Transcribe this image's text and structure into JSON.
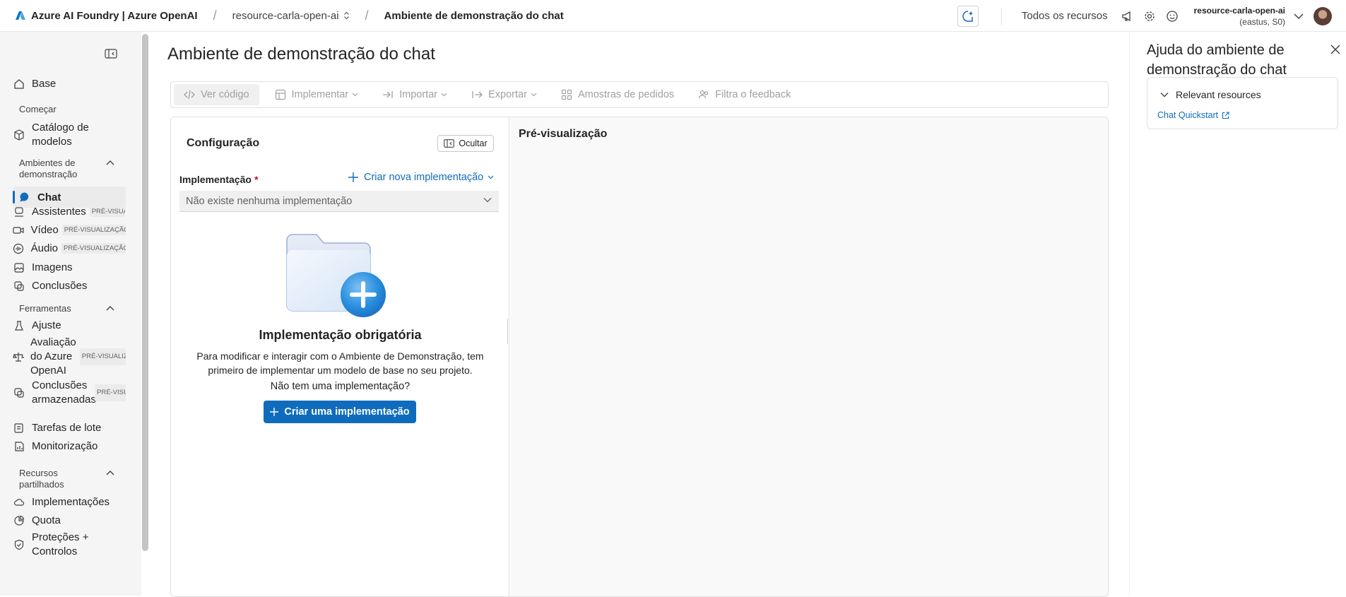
{
  "topbar": {
    "brand": "Azure AI Foundry | Azure OpenAI",
    "resource": "resource-carla-open-ai",
    "page": "Ambiente de demonstração do chat",
    "all_resources": "Todos os recursos",
    "account_name": "resource-carla-open-ai",
    "account_region": "(eastus, S0)"
  },
  "sidebar": {
    "base": "Base",
    "sec_start": "Começar",
    "catalog": "Catálogo de modelos",
    "sec_playgrounds": "Ambientes de demonstração",
    "chat": "Chat",
    "assistants": "Assistentes",
    "assistants_badge": "PRÉ-VISUALI",
    "video": "Vídeo",
    "video_badge": "PRÉ-VISUALIZAÇÃO",
    "audio": "Áudio",
    "audio_badge": "PRÉ-VISUALIZAÇÃO",
    "images": "Imagens",
    "completions": "Conclusões",
    "sec_tools": "Ferramentas",
    "finetune": "Ajuste",
    "eval": "Avaliação do Azure OpenAI",
    "eval_badge": "PRÉ-VISUALIZA",
    "stored": "Conclusões armazenadas",
    "stored_badge": "PRÉ-VISUA",
    "batch": "Tarefas de lote",
    "monitoring": "Monitorização",
    "sec_shared": "Recursos partilhados",
    "deployments": "Implementações",
    "quota": "Quota",
    "protections": "Proteções + Controlos"
  },
  "main": {
    "title": "Ambiente de demonstração do chat",
    "toolbar": {
      "view_code": "Ver código",
      "deploy": "Implementar",
      "import": "Importar",
      "export": "Exportar",
      "samples": "Amostras de pedidos",
      "feedback": "Filtra o feedback"
    },
    "config": {
      "title": "Configuração",
      "hide": "Ocultar",
      "deployment_label": "Implementação",
      "required": "*",
      "create_new": "Criar nova implementação",
      "select_value": "Não existe nenhuma implementação",
      "empty_title": "Implementação obrigatória",
      "empty_desc": "Para modificar e interagir com o Ambiente de Demonstração, tem primeiro de implementar um modelo de base no seu projeto.",
      "no_impl": "Não tem uma implementação?",
      "create_btn": "Criar uma implementação"
    },
    "preview_title": "Pré-visualização"
  },
  "help": {
    "title": "Ajuda do ambiente de demonstração do chat",
    "resources_title": "Relevant resources",
    "link": "Chat Quickstart"
  },
  "colors": {
    "accent": "#0f6cbd",
    "required": "#c50f1f"
  }
}
